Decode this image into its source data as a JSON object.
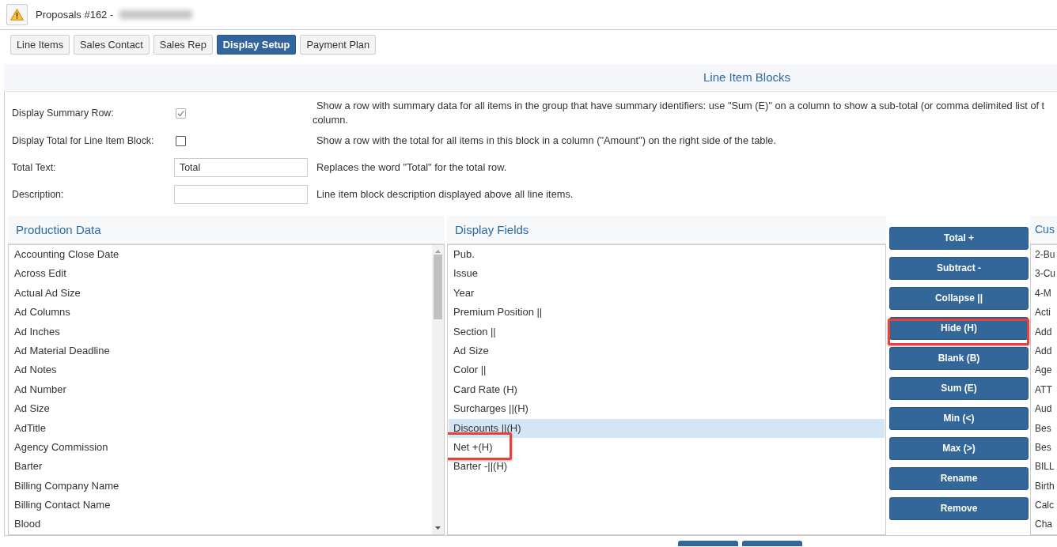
{
  "title_bar": {
    "title": "Proposals #162 -",
    "title_redacted": true
  },
  "tabs": [
    {
      "label": "Line Items",
      "selected": false
    },
    {
      "label": "Sales Contact",
      "selected": false
    },
    {
      "label": "Sales Rep",
      "selected": false
    },
    {
      "label": "Display Setup",
      "selected": true
    },
    {
      "label": "Payment Plan",
      "selected": false
    }
  ],
  "block": {
    "title": "Line Item Blocks",
    "options": [
      {
        "kind": "checkbox",
        "label": "Display Summary Row:",
        "checked": true,
        "disabled": true,
        "description_lines": [
          "Show a row with summary data for all items in the group that have summary identifiers: use \"Sum (E)\" on a column to show a sub-total (or comma delimited list of t",
          "column."
        ]
      },
      {
        "kind": "checkbox",
        "label": "Display Total for Line Item Block:",
        "checked": false,
        "disabled": false,
        "description_lines": [
          "Show a row with the total for all items in this block in a column (\"Amount\") on the right side of the table."
        ]
      },
      {
        "kind": "text",
        "label": "Total Text:",
        "value": "Total",
        "disabled": false,
        "description_lines": [
          "Replaces the word \"Total\" for the total row."
        ]
      },
      {
        "kind": "text",
        "label": "Description:",
        "disabled": false,
        "description_lines": [
          "Line item block description displayed above all line items."
        ]
      }
    ]
  },
  "production_data": {
    "title": "Production Data",
    "items": [
      {
        "label": "Accounting Close Date",
        "selected": false
      },
      {
        "label": "Across Edit",
        "selected": false
      },
      {
        "label": "Actual Ad Size",
        "selected": false
      },
      {
        "label": "Ad Columns",
        "selected": false
      },
      {
        "label": "Ad Inches",
        "selected": false
      },
      {
        "label": "Ad Material Deadline",
        "selected": false
      },
      {
        "label": "Ad Notes",
        "selected": false
      },
      {
        "label": "Ad Number",
        "selected": false
      },
      {
        "label": "Ad Size",
        "selected": false
      },
      {
        "label": "AdTitle",
        "selected": false
      },
      {
        "label": "Agency Commission",
        "selected": false
      },
      {
        "label": "Barter",
        "selected": false
      },
      {
        "label": "Billing Company Name",
        "selected": false
      },
      {
        "label": "Billing Contact Name",
        "selected": false
      },
      {
        "label": "Blood",
        "selected": false
      }
    ]
  },
  "display_fields": {
    "title": "Display Fields",
    "items": [
      {
        "label": "Pub.",
        "selected": false,
        "outlined": false
      },
      {
        "label": "Issue",
        "selected": false,
        "outlined": false
      },
      {
        "label": "Year",
        "selected": false,
        "outlined": false
      },
      {
        "label": "Premium Position ||",
        "selected": false,
        "outlined": false
      },
      {
        "label": "Section ||",
        "selected": false,
        "outlined": false
      },
      {
        "label": "Ad Size",
        "selected": false,
        "outlined": false
      },
      {
        "label": "Color ||",
        "selected": false,
        "outlined": false
      },
      {
        "label": "Card Rate (H)",
        "selected": false,
        "outlined": false
      },
      {
        "label": "Surcharges ||(H)",
        "selected": false,
        "outlined": false
      },
      {
        "label": "Discounts ||(H)",
        "selected": true,
        "outlined": false
      },
      {
        "label": "Net +(H)",
        "selected": false,
        "outlined": true
      },
      {
        "label": "Barter -||(H)",
        "selected": false,
        "outlined": false
      }
    ]
  },
  "actions": [
    {
      "label": "Total +",
      "outlined": false
    },
    {
      "label": "Subtract -",
      "outlined": false
    },
    {
      "label": "Collapse ||",
      "outlined": false
    },
    {
      "label": "Hide (H)",
      "outlined": true
    },
    {
      "label": "Blank (B)",
      "outlined": false
    },
    {
      "label": "Sum (E)",
      "outlined": false
    },
    {
      "label": "Min (<)",
      "outlined": false
    },
    {
      "label": "Max (>)",
      "outlined": false
    },
    {
      "label": "Rename",
      "outlined": false
    },
    {
      "label": "Remove",
      "outlined": false
    }
  ],
  "custom_panel": {
    "title": "Cus",
    "items": [
      {
        "label": "2-Bu",
        "selected": false
      },
      {
        "label": "3-Cu",
        "selected": false
      },
      {
        "label": "4-M",
        "selected": false
      },
      {
        "label": "Acti",
        "selected": false
      },
      {
        "label": "Add",
        "selected": false
      },
      {
        "label": "Add",
        "selected": false
      },
      {
        "label": "Age",
        "selected": false
      },
      {
        "label": "ATT",
        "selected": false
      },
      {
        "label": "Aud",
        "selected": false
      },
      {
        "label": "Bes",
        "selected": false
      },
      {
        "label": "Bes",
        "selected": false
      },
      {
        "label": "BILL",
        "selected": false
      },
      {
        "label": "Birth",
        "selected": false
      },
      {
        "label": "Calc",
        "selected": false
      },
      {
        "label": "Cha",
        "selected": false
      }
    ]
  },
  "footer": {
    "buttons": [
      {
        "kind": "primary"
      },
      {
        "kind": "primary"
      }
    ]
  }
}
